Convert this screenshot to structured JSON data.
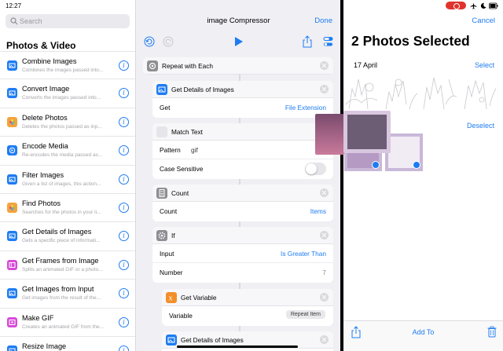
{
  "status": {
    "time": "12:27"
  },
  "sidebar": {
    "search_placeholder": "Search",
    "section_title": "Photos & Video",
    "items": [
      {
        "title": "Combine Images",
        "desc": "Combines the images passed into...",
        "color": "#1e7cf2",
        "icon": "photo-icon"
      },
      {
        "title": "Convert Image",
        "desc": "Converts the images passed into...",
        "color": "#1e7cf2",
        "icon": "photo-icon"
      },
      {
        "title": "Delete Photos",
        "desc": "Deletes the photos passed as inp...",
        "color": "#f3a33c",
        "icon": "photos-app-icon"
      },
      {
        "title": "Encode Media",
        "desc": "Re-encodes the media passed as...",
        "color": "#1e7cf2",
        "icon": "encode-icon"
      },
      {
        "title": "Filter Images",
        "desc": "Given a list of images, this action...",
        "color": "#1e7cf2",
        "icon": "photo-icon"
      },
      {
        "title": "Find Photos",
        "desc": "Searches for the photos in your li...",
        "color": "#f3a33c",
        "icon": "photos-app-icon"
      },
      {
        "title": "Get Details of Images",
        "desc": "Gets a specific piece of informati...",
        "color": "#1e7cf2",
        "icon": "photo-icon"
      },
      {
        "title": "Get Frames from Image",
        "desc": "Splits an animated GIF or a photo...",
        "color": "#d74ad8",
        "icon": "frames-icon"
      },
      {
        "title": "Get Images from Input",
        "desc": "Get images from the result of the...",
        "color": "#1e7cf2",
        "icon": "photo-icon"
      },
      {
        "title": "Make GIF",
        "desc": "Creates an animated GIF from the...",
        "color": "#d74ad8",
        "icon": "gif-icon"
      },
      {
        "title": "Resize Image",
        "desc": "",
        "color": "#1e7cf2",
        "icon": "photo-icon"
      }
    ]
  },
  "editor": {
    "title": "image Compressor",
    "done_label": "Done",
    "cards": {
      "repeat": {
        "label": "Repeat with Each"
      },
      "details": {
        "label": "Get Details of Images",
        "row_key": "Get",
        "row_value": "File Extension"
      },
      "match": {
        "label": "Match Text",
        "pattern_key": "Pattern",
        "pattern_value": "gif",
        "case_key": "Case Sensitive",
        "case_sensitive": false
      },
      "count": {
        "label": "Count",
        "row_key": "Count",
        "row_value": "Items"
      },
      "if": {
        "label": "If",
        "input_key": "Input",
        "input_value": "Is Greater Than",
        "number_key": "Number",
        "number_value": "7"
      },
      "getvar": {
        "label": "Get Variable",
        "row_key": "Variable",
        "row_value": "Repeat Item"
      },
      "details2": {
        "label": "Get Details of Images"
      }
    }
  },
  "photos": {
    "title": "2 Photos Selected",
    "cancel_label": "Cancel",
    "date_label": "17 April",
    "select_label": "Select",
    "deselect_label": "Deselect",
    "add_to_label": "Add To",
    "accent": "#1e7cf2"
  }
}
